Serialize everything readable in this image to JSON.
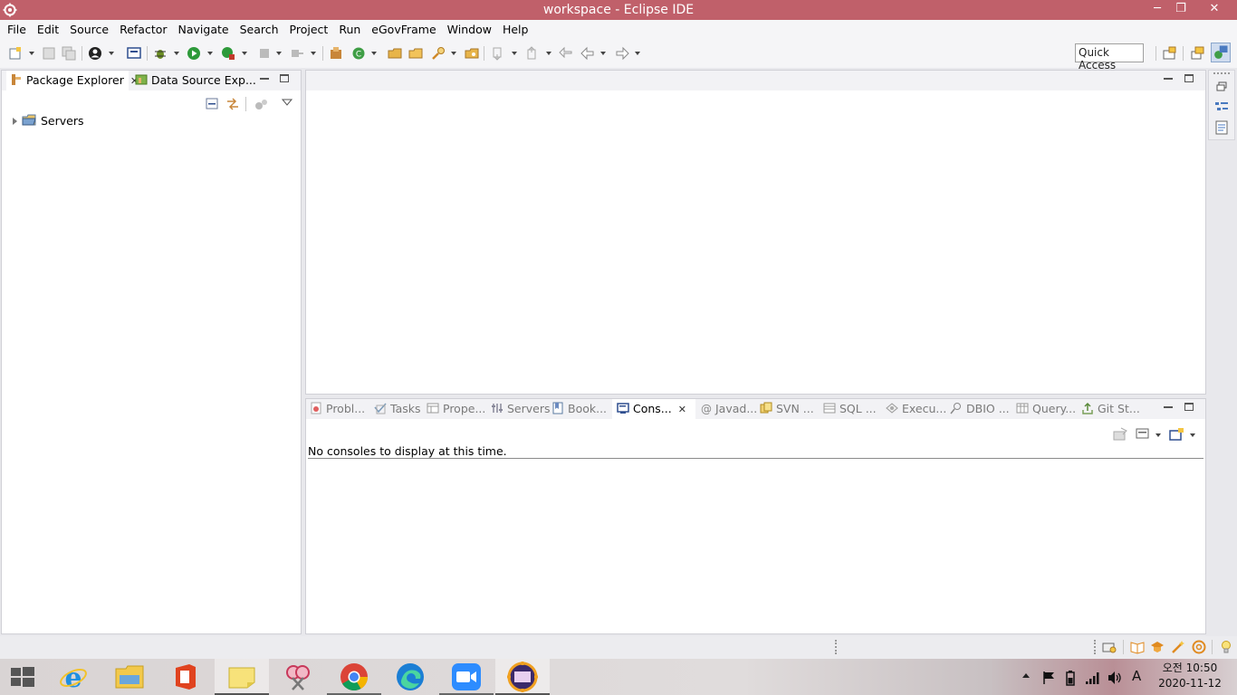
{
  "window": {
    "title": "workspace - Eclipse IDE",
    "minimize_glyph": "─",
    "restore_glyph": "❐",
    "close_glyph": "✕"
  },
  "menubar": {
    "items": [
      "File",
      "Edit",
      "Source",
      "Refactor",
      "Navigate",
      "Search",
      "Project",
      "Run",
      "eGovFrame",
      "Window",
      "Help"
    ]
  },
  "toolbar": {
    "quick_access": "Quick Access"
  },
  "left_panel": {
    "tabs": [
      {
        "label": "Package Explorer",
        "icon": "package-explorer-icon",
        "active": true
      },
      {
        "label": "Data Source Exp...",
        "icon": "data-source-icon",
        "active": false
      }
    ],
    "tree": [
      {
        "label": "Servers",
        "icon": "folder-icon",
        "expanded": false
      }
    ]
  },
  "console_panel": {
    "tabs": [
      {
        "label": "Probl...",
        "icon": "problems-icon"
      },
      {
        "label": "Tasks",
        "icon": "tasks-icon"
      },
      {
        "label": "Prope...",
        "icon": "properties-icon"
      },
      {
        "label": "Servers",
        "icon": "servers-icon"
      },
      {
        "label": "Book...",
        "icon": "bookmarks-icon"
      },
      {
        "label": "Cons...",
        "icon": "console-icon",
        "active": true
      },
      {
        "label": "Javad...",
        "icon": "javadoc-icon"
      },
      {
        "label": "SVN ...",
        "icon": "svn-icon"
      },
      {
        "label": "SQL ...",
        "icon": "sql-icon"
      },
      {
        "label": "Execu...",
        "icon": "execution-icon"
      },
      {
        "label": "DBIO ...",
        "icon": "dbio-icon"
      },
      {
        "label": "Query...",
        "icon": "query-icon"
      },
      {
        "label": "Git St...",
        "icon": "git-staging-icon"
      }
    ],
    "message": "No consoles to display at this time."
  },
  "taskbar": {
    "apps": [
      "start-icon",
      "internet-explorer-icon",
      "file-explorer-icon",
      "office-icon",
      "sticky-notes-icon",
      "snipping-tool-icon",
      "chrome-icon",
      "edge-icon",
      "zoom-icon",
      "eclipse-icon"
    ],
    "ime": "A",
    "clock": {
      "time": "오전 10:50",
      "date": "2020-11-12"
    }
  },
  "colors": {
    "titlebar": "#c0606a",
    "accent": "#2f6cc0"
  }
}
